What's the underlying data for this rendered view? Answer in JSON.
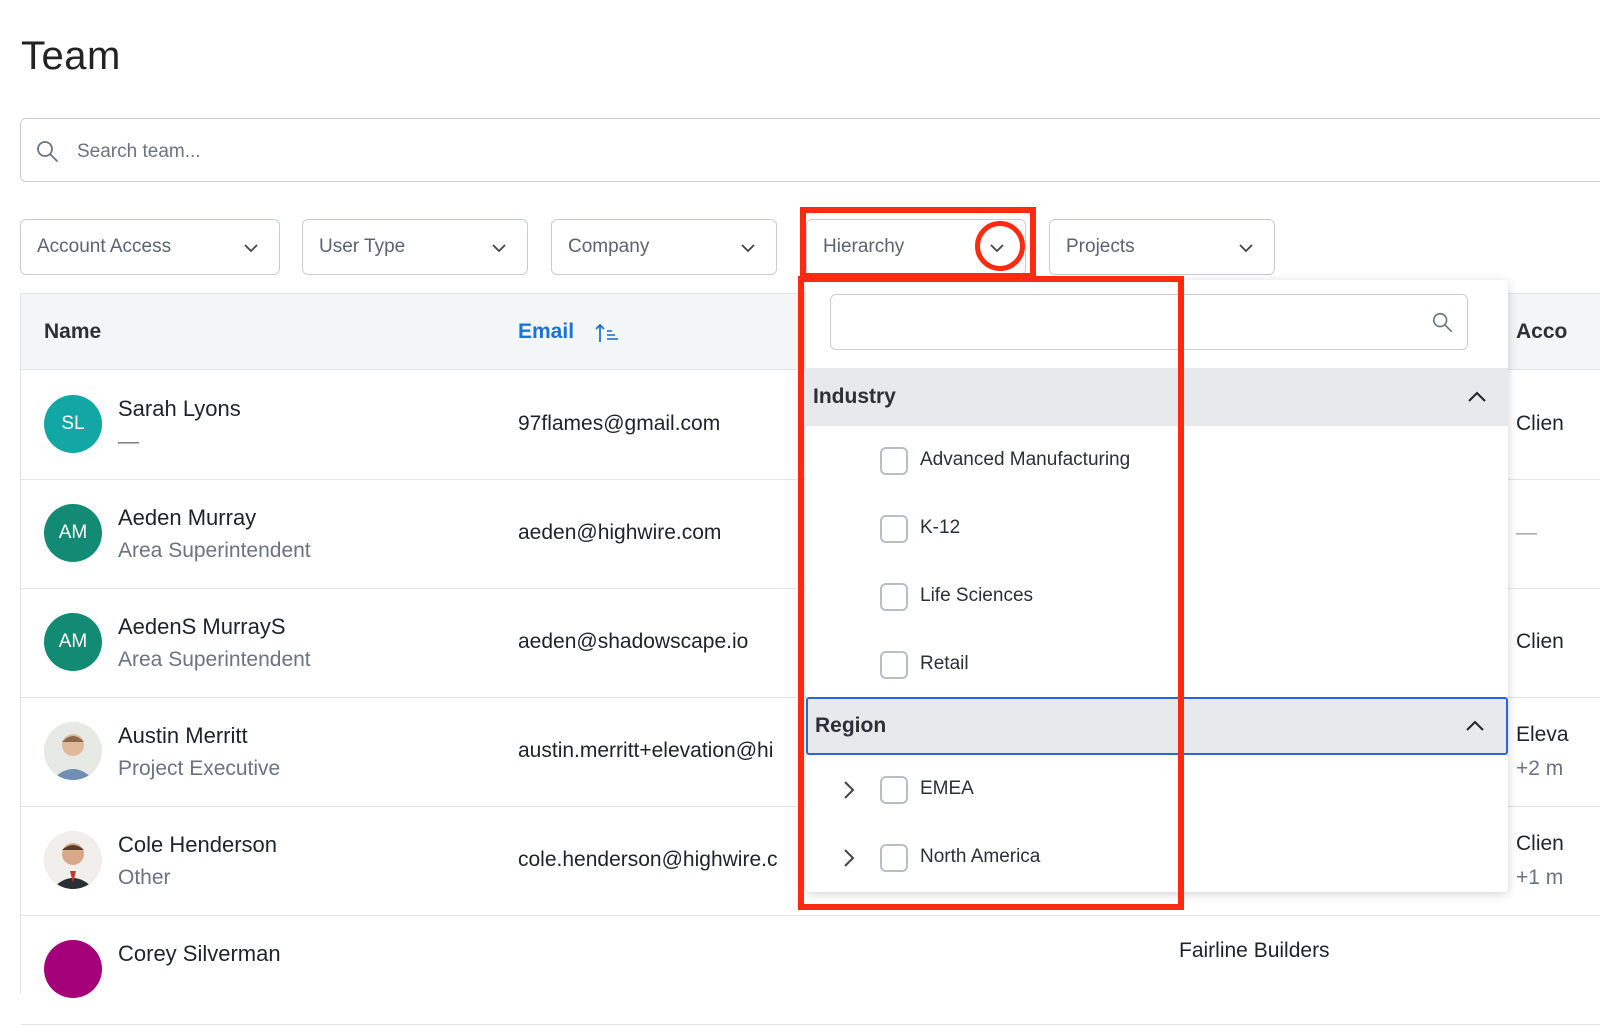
{
  "page": {
    "title": "Team"
  },
  "search": {
    "placeholder": "Search team..."
  },
  "filters": [
    {
      "label": "Account Access"
    },
    {
      "label": "User Type"
    },
    {
      "label": "Company"
    },
    {
      "label": "Hierarchy"
    },
    {
      "label": "Projects"
    }
  ],
  "table": {
    "columns": {
      "name": "Name",
      "email": "Email",
      "account": "Acco"
    },
    "rows": [
      {
        "initials": "SL",
        "name": "Sarah Lyons",
        "subtitle": "—",
        "email": "97flames@gmail.com",
        "account": "Clien",
        "account_sub": "",
        "avatar_color": "#12a7a4"
      },
      {
        "initials": "AM",
        "name": "Aeden Murray",
        "subtitle": "Area Superintendent",
        "email": "aeden@highwire.com",
        "account": "—",
        "account_sub": "",
        "avatar_color": "#138a73"
      },
      {
        "initials": "AM",
        "name": "AedenS MurrayS",
        "subtitle": "Area Superintendent",
        "email": "aeden@shadowscape.io",
        "account": "Clien",
        "account_sub": "",
        "avatar_color": "#138a73"
      },
      {
        "initials": "",
        "name": "Austin Merritt",
        "subtitle": "Project Executive",
        "email": "austin.merritt+elevation@hi",
        "account": "Eleva",
        "account_sub": "+2 m",
        "avatar_color": ""
      },
      {
        "initials": "",
        "name": "Cole Henderson",
        "subtitle": "Other",
        "email": "cole.henderson@highwire.c",
        "account": "Clien",
        "account_sub": "+1 m",
        "avatar_color": ""
      },
      {
        "initials": "",
        "name": "Corey Silverman",
        "subtitle": "",
        "email": "",
        "company": "Fairline Builders",
        "account": "",
        "account_sub": "",
        "avatar_color": "#a3007a"
      }
    ]
  },
  "dropdown": {
    "search_placeholder": "",
    "groups": [
      {
        "label": "Industry",
        "options": [
          "Advanced Manufacturing",
          "K-12",
          "Life Sciences",
          "Retail"
        ]
      },
      {
        "label": "Region",
        "options": [
          "EMEA",
          "North America"
        ]
      }
    ]
  },
  "colors": {
    "highlight": "#ff2a10",
    "accent": "#1a73d9",
    "focus": "#2a66d8"
  }
}
